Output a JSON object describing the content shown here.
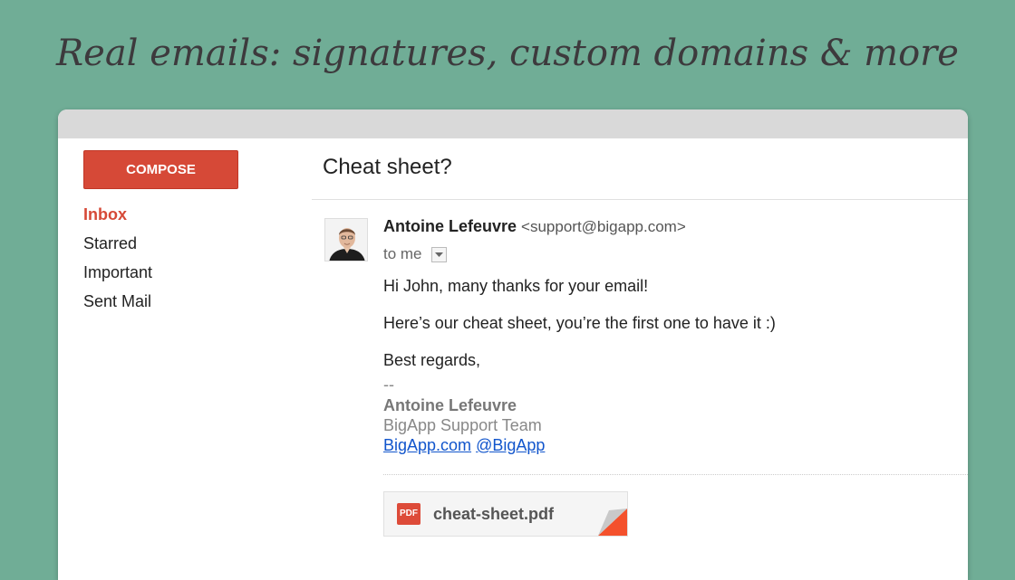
{
  "headline": "Real emails: signatures, custom domains & more",
  "sidebar": {
    "compose_label": "COMPOSE",
    "items": [
      {
        "label": "Inbox",
        "active": true
      },
      {
        "label": "Starred",
        "active": false
      },
      {
        "label": "Important",
        "active": false
      },
      {
        "label": "Sent Mail",
        "active": false
      }
    ]
  },
  "message": {
    "subject": "Cheat sheet?",
    "sender_name": "Antoine Lefeuvre",
    "sender_email": "<support@bigapp.com>",
    "to_label": "to me",
    "body": [
      "Hi John, many thanks for your email!",
      "Here’s our cheat sheet, you’re the first one to have it :)",
      "Best regards,"
    ],
    "signature": {
      "separator": "--",
      "name": "Antoine Lefeuvre",
      "team": "BigApp Support Team",
      "link_site": "BigApp.com",
      "link_handle": "@BigApp"
    },
    "attachment": {
      "type_badge": "PDF",
      "filename": "cheat-sheet.pdf"
    }
  },
  "colors": {
    "background": "#70ad96",
    "compose": "#d64937",
    "link": "#1155cc"
  },
  "icons": {
    "avatar": "avatar-photo",
    "to_dropdown": "chevron-down-icon",
    "attachment": "pdf-icon"
  }
}
